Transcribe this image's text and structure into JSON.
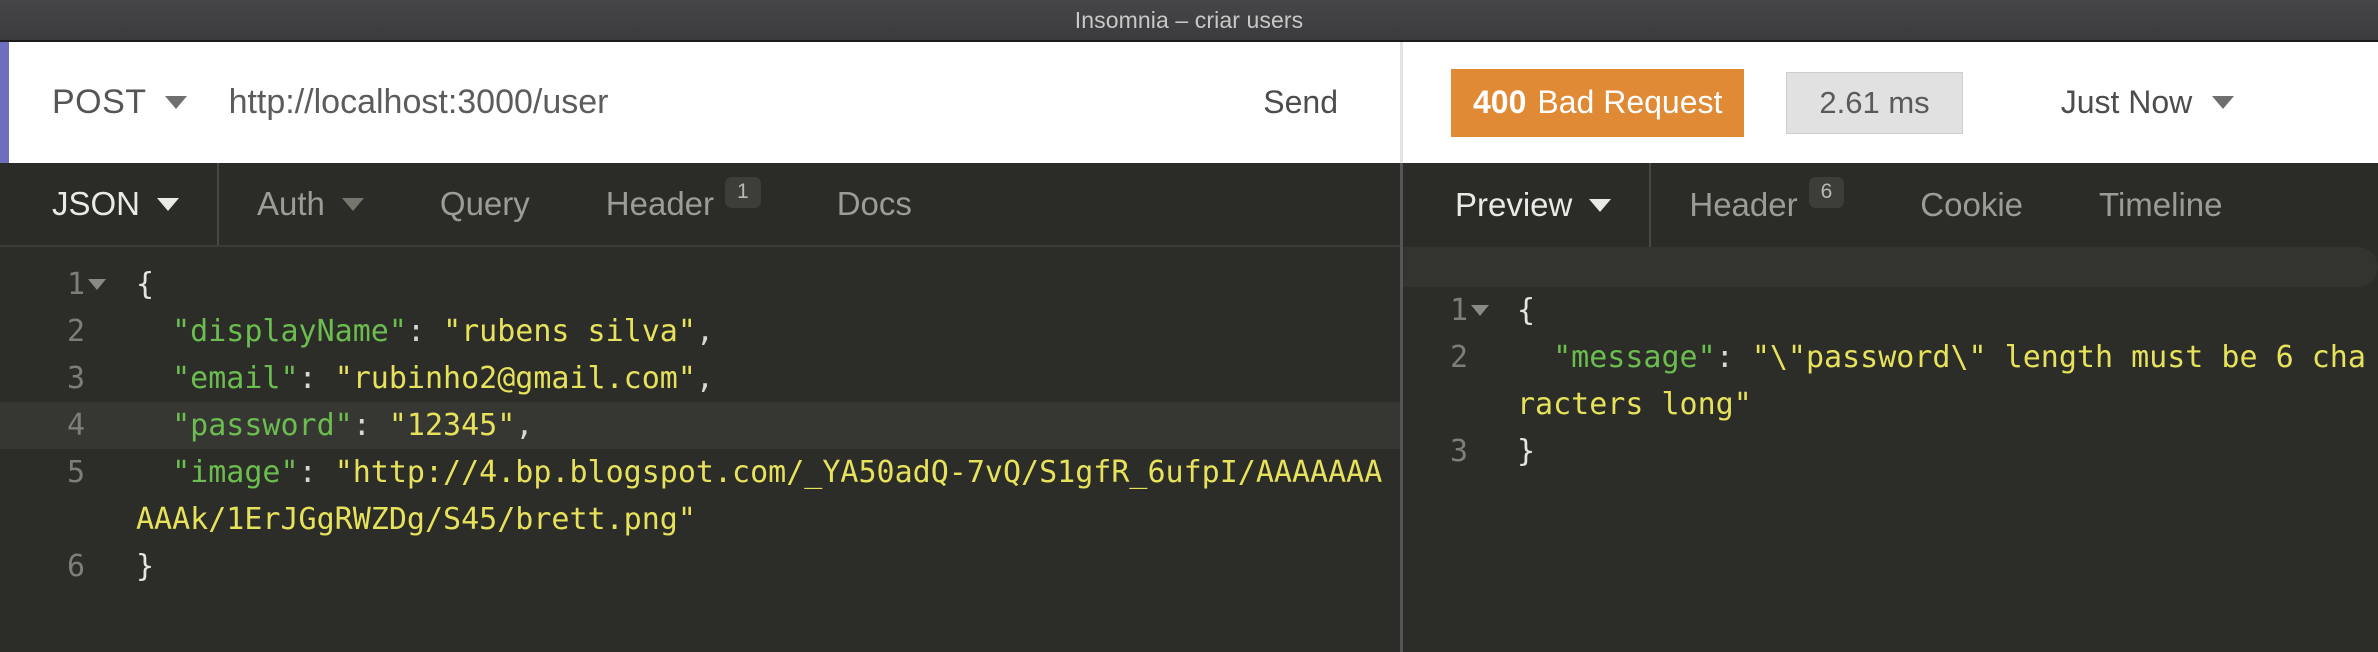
{
  "window": {
    "title": "Insomnia – criar users"
  },
  "request_bar": {
    "method": "POST",
    "method_caret_icon": "chevron-down-icon",
    "url": "http://localhost:3000/user",
    "send_label": "Send"
  },
  "response_meta": {
    "status_code": "400",
    "status_label": "Bad Request",
    "status_color": "#e08a35",
    "elapsed": "2.61 ms",
    "when": "Just Now",
    "when_caret_icon": "chevron-down-icon"
  },
  "request_tabs": [
    {
      "label": "JSON",
      "active": true,
      "caret": true,
      "badge": ""
    },
    {
      "label": "Auth",
      "active": false,
      "caret": true,
      "badge": ""
    },
    {
      "label": "Query",
      "active": false,
      "caret": false,
      "badge": ""
    },
    {
      "label": "Header",
      "active": false,
      "caret": false,
      "badge": "1"
    },
    {
      "label": "Docs",
      "active": false,
      "caret": false,
      "badge": ""
    }
  ],
  "response_tabs": [
    {
      "label": "Preview",
      "active": true,
      "caret": true,
      "badge": ""
    },
    {
      "label": "Header",
      "active": false,
      "caret": false,
      "badge": "6"
    },
    {
      "label": "Cookie",
      "active": false,
      "caret": false,
      "badge": ""
    },
    {
      "label": "Timeline",
      "active": false,
      "caret": false,
      "badge": ""
    }
  ],
  "request_body": {
    "lines": [
      {
        "num": "1",
        "fold": true,
        "highlight": false,
        "tokens": [
          {
            "t": "{",
            "c": "brace"
          }
        ]
      },
      {
        "num": "2",
        "fold": false,
        "highlight": false,
        "tokens": [
          {
            "t": "  ",
            "c": "punc"
          },
          {
            "t": "\"displayName\"",
            "c": "key"
          },
          {
            "t": ": ",
            "c": "punc"
          },
          {
            "t": "\"rubens silva\"",
            "c": "str"
          },
          {
            "t": ",",
            "c": "punc"
          }
        ]
      },
      {
        "num": "3",
        "fold": false,
        "highlight": false,
        "tokens": [
          {
            "t": "  ",
            "c": "punc"
          },
          {
            "t": "\"email\"",
            "c": "key"
          },
          {
            "t": ": ",
            "c": "punc"
          },
          {
            "t": "\"rubinho2@gmail.com\"",
            "c": "str"
          },
          {
            "t": ",",
            "c": "punc"
          }
        ]
      },
      {
        "num": "4",
        "fold": false,
        "highlight": true,
        "tokens": [
          {
            "t": "  ",
            "c": "punc"
          },
          {
            "t": "\"password\"",
            "c": "key"
          },
          {
            "t": ": ",
            "c": "punc"
          },
          {
            "t": "\"12345\"",
            "c": "str"
          },
          {
            "t": ",",
            "c": "punc"
          }
        ]
      },
      {
        "num": "5",
        "fold": false,
        "highlight": false,
        "tokens": [
          {
            "t": "  ",
            "c": "punc"
          },
          {
            "t": "\"image\"",
            "c": "key"
          },
          {
            "t": ": ",
            "c": "punc"
          },
          {
            "t": "\"http://4.bp.blogspot.com/_YA50adQ-7vQ/S1gfR_6ufpI/AAAAAAAAAAk/1ErJGgRWZDg/S45/brett.png\"",
            "c": "str"
          }
        ]
      },
      {
        "num": "6",
        "fold": false,
        "highlight": false,
        "tokens": [
          {
            "t": "}",
            "c": "brace"
          }
        ]
      }
    ]
  },
  "response_body": {
    "lines": [
      {
        "num": "1",
        "fold": true,
        "highlight": false,
        "tokens": [
          {
            "t": "{",
            "c": "brace"
          }
        ]
      },
      {
        "num": "2",
        "fold": false,
        "highlight": false,
        "tokens": [
          {
            "t": "  ",
            "c": "punc"
          },
          {
            "t": "\"message\"",
            "c": "key"
          },
          {
            "t": ": ",
            "c": "punc"
          },
          {
            "t": "\"\\\"password\\\" length must be 6 characters long\"",
            "c": "str"
          }
        ]
      },
      {
        "num": "3",
        "fold": false,
        "highlight": false,
        "tokens": [
          {
            "t": "}",
            "c": "brace"
          }
        ]
      }
    ]
  }
}
